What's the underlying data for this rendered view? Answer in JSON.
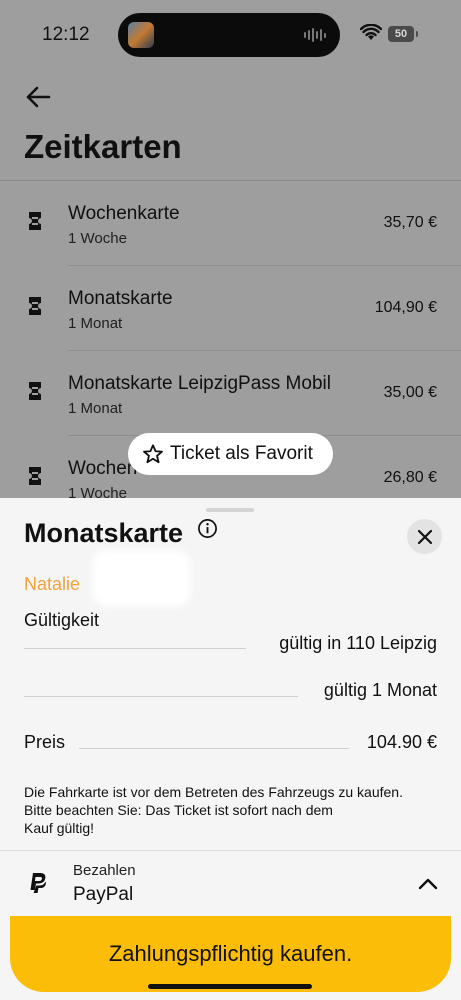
{
  "status_bar": {
    "time": "12:12",
    "battery": "50"
  },
  "header": {
    "title": "Zeitkarten"
  },
  "tickets": [
    {
      "name": "Wochenkarte",
      "duration": "1 Woche",
      "price": "35,70 €"
    },
    {
      "name": "Monatskarte",
      "duration": "1 Monat",
      "price": "104,90 €"
    },
    {
      "name": "Monatskarte LeipzigPass Mobil",
      "duration": "1 Monat",
      "price": "35,00 €"
    },
    {
      "name": "Wochen",
      "duration": "1 Woche",
      "price": "26,80 €"
    }
  ],
  "favorite_button": {
    "label": "Ticket als Favorit"
  },
  "sheet": {
    "title": "Monatskarte",
    "holder_name": "Natalie",
    "validity_label": "Gültigkeit",
    "validity_zone": "gültig in 110 Leipzig",
    "validity_duration": "gültig 1 Monat",
    "price_label": "Preis",
    "price_value": "104.90 €",
    "notice_line1": "Die Fahrkarte ist vor dem Betreten des Fahrzeugs zu kaufen.",
    "notice_line2": "Bitte beachten Sie: Das Ticket ist sofort nach dem",
    "notice_line3": "Kauf gültig!",
    "payment_label": "Bezahlen",
    "payment_method": "PayPal",
    "buy_button": "Zahlungspflichtig kaufen."
  },
  "colors": {
    "accent": "#fbbd08",
    "holder": "#f2a33a",
    "overlay": "#9e9e9e"
  }
}
